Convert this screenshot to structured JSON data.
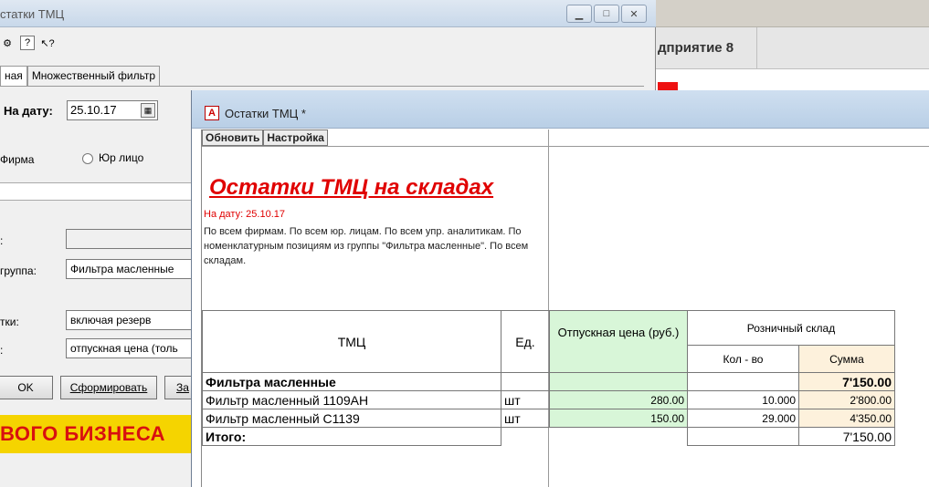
{
  "bg_app": {
    "title": "дприятие 8"
  },
  "dialog": {
    "title": "статки ТМЦ",
    "window_buttons": [
      "▁",
      "□",
      "✕"
    ],
    "tabs": [
      "ная",
      "Множественный фильтр"
    ],
    "date_label": "На дату:",
    "date_value": "25.10.17",
    "radio_firma": "Фирма",
    "radio_yur": "Юр лицо",
    "row_labels": [
      ":",
      "группа:",
      "тки:",
      ":"
    ],
    "fields": [
      "",
      "Фильтра масленные",
      "включая резерв",
      "отпускная цена (толь"
    ],
    "buttons": {
      "ok": "OK",
      "form": "Сформировать",
      "extra": "За"
    },
    "banner": "ВОГО БИЗНЕСА"
  },
  "report_window": {
    "title": "Остатки ТМЦ  *",
    "toolbar": {
      "refresh": "Обновить",
      "settings": "Настройка"
    },
    "report_title": "Остатки ТМЦ на складах",
    "date_line": "На дату: 25.10.17",
    "description": "По всем фирмам. По всем юр. лицам. По всем упр. аналитикам. По номенклатурным позициям из группы \"Фильтра масленные\". По всем складам.",
    "table": {
      "headers": {
        "item": "ТМЦ",
        "unit": "Ед.",
        "price": "Отпускная цена (руб.)",
        "warehouse": "Розничный склад",
        "qty": "Кол - во",
        "sum": "Сумма"
      },
      "group": {
        "name": "Фильтра масленные",
        "sum": "7'150.00"
      },
      "rows": [
        {
          "item": "Фильтр масленный 1109АН",
          "unit": "шт",
          "price": "280.00",
          "qty": "10.000",
          "sum": "2'800.00"
        },
        {
          "item": "Фильтр масленный С1139",
          "unit": "шт",
          "price": "150.00",
          "qty": "29.000",
          "sum": "4'350.00"
        }
      ],
      "total": {
        "label": "Итого:",
        "sum": "7'150.00"
      }
    }
  }
}
